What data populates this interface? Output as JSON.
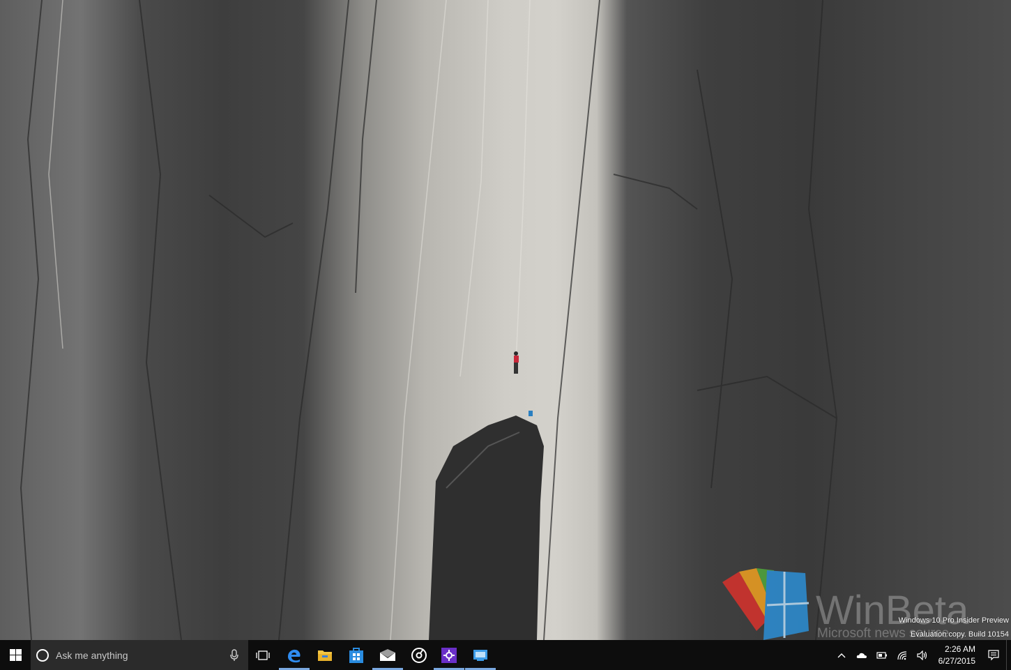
{
  "desktop": {
    "watermark_line1": "Windows 10 Pro Insider Preview",
    "watermark_line2": "Evaluation copy. Build 10154",
    "logo_text": "WinBeta",
    "logo_subtext": "Microsoft news source"
  },
  "taskbar": {
    "search_placeholder": "Ask me anything",
    "pinned_apps": [
      "Microsoft Edge",
      "File Explorer",
      "Store",
      "Mail",
      "Groove Music",
      "App",
      "Desktop App"
    ],
    "clock": {
      "time": "2:26 AM",
      "date": "6/27/2015"
    }
  },
  "colors": {
    "taskbar_bg": "#0d0d0d",
    "search_bg": "#2b2b2b",
    "accent": "#7aa8e0"
  }
}
